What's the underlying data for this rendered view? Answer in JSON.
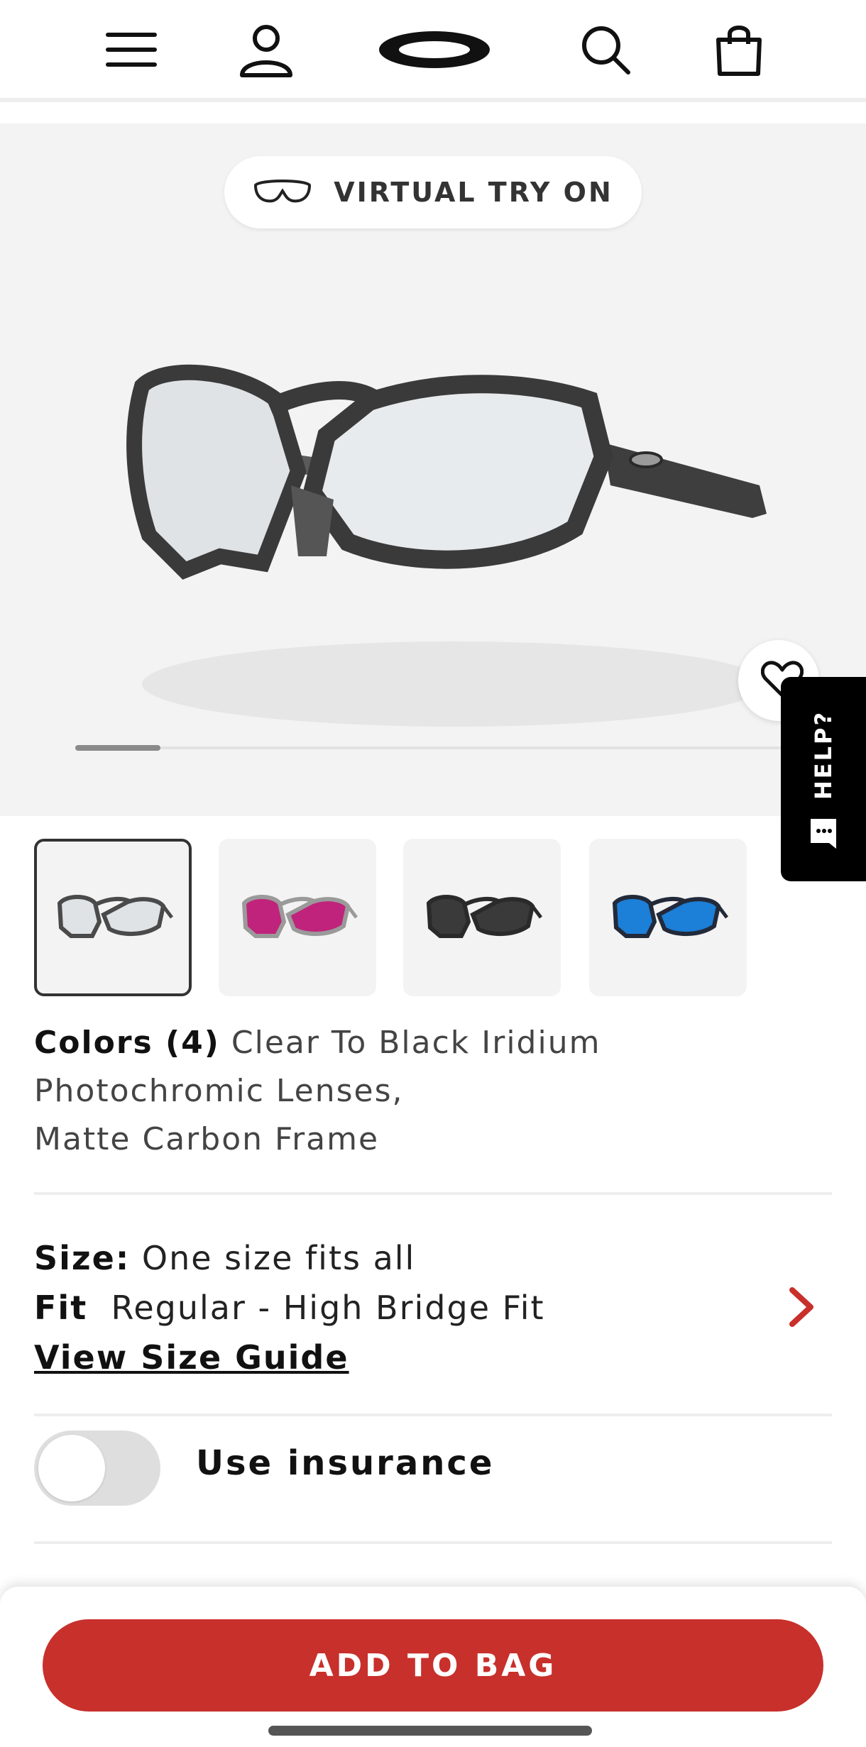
{
  "header": {
    "icons": [
      "menu-icon",
      "account-icon",
      "brand-logo",
      "search-icon",
      "bag-icon"
    ]
  },
  "hero": {
    "virtual_try_on_label": "VIRTUAL TRY ON",
    "gallery_progress": 0.11
  },
  "help": {
    "label": "HELP?"
  },
  "thumbnails": [
    {
      "lens_color": "#dfe3e6",
      "frame_color": "#4a4a4a",
      "selected": true
    },
    {
      "lens_color": "#c0237b",
      "frame_color": "#9a9a9a",
      "selected": false
    },
    {
      "lens_color": "#3a3a3a",
      "frame_color": "#2a2a2a",
      "selected": false
    },
    {
      "lens_color": "#1c7fd8",
      "frame_color": "#222a3a",
      "selected": false
    }
  ],
  "product": {
    "colors_label": "Colors (4)",
    "color_line1": "Clear To Black Iridium",
    "color_line2": "Photochromic Lenses,",
    "color_line3": "Matte Carbon Frame",
    "size_label": "Size:",
    "size_value": "One size fits all",
    "fit_label": "Fit",
    "fit_value": "Regular - High Bridge Fit",
    "size_guide_label": "View Size Guide"
  },
  "insurance": {
    "label": "Use insurance",
    "enabled": false
  },
  "cta": {
    "add_to_bag_label": "ADD TO BAG"
  },
  "colors": {
    "accent": "#c8302c",
    "help_bg": "#000000"
  }
}
